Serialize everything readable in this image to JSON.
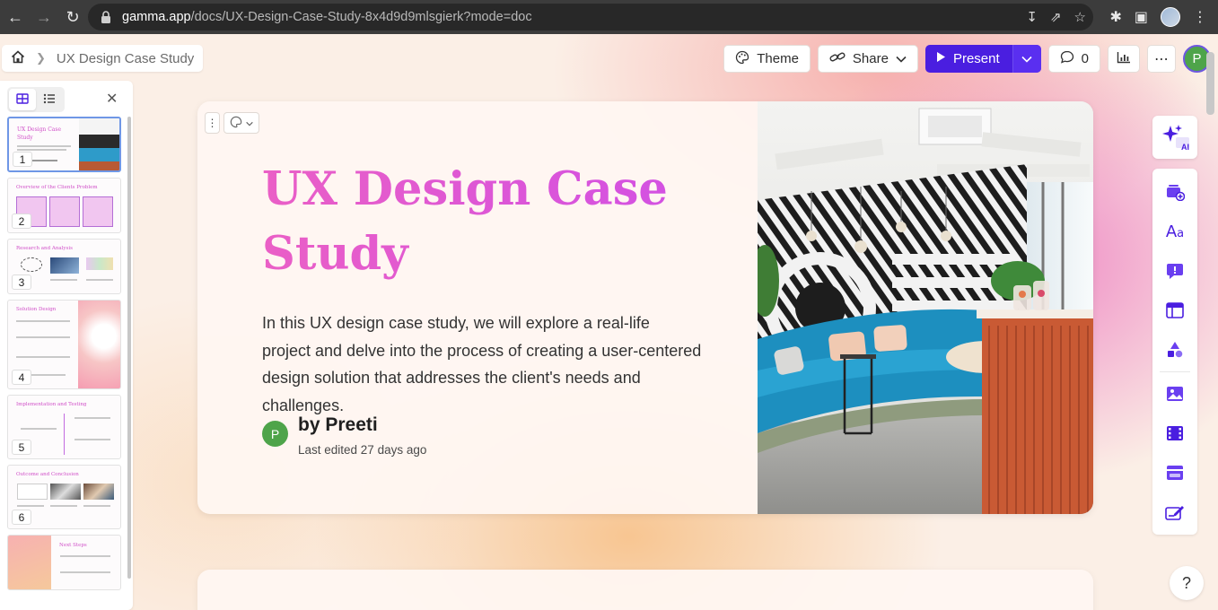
{
  "browser": {
    "url_host": "gamma.app",
    "url_path": "/docs/UX-Design-Case-Study-8x4d9d9mlsgierk?mode=doc"
  },
  "breadcrumb": {
    "doc_title": "UX Design Case Study"
  },
  "toolbar": {
    "theme_label": "Theme",
    "share_label": "Share",
    "present_label": "Present",
    "comment_count": "0",
    "avatar_initial": "P"
  },
  "panel": {
    "thumbnails": [
      {
        "number": "1",
        "title": "UX Design Case Study"
      },
      {
        "number": "2",
        "title": "Overview of the Clients Problem"
      },
      {
        "number": "3",
        "title": "Research and Analysis"
      },
      {
        "number": "4",
        "title": "Solution Design"
      },
      {
        "number": "5",
        "title": "Implementation and Testing"
      },
      {
        "number": "6",
        "title": "Outcome and Conclusion"
      },
      {
        "number": "",
        "title": "Next Steps"
      }
    ]
  },
  "slide": {
    "title": "UX Design Case Study",
    "description": "In this UX design case study, we will explore a real-life project and delve into the process of creating a user-centered design solution that addresses the client's needs and challenges.",
    "author_initial": "P",
    "author": "by Preeti",
    "last_edited": "Last edited 27 days ago"
  },
  "right_toolbar": {
    "ai_badge": "AI"
  },
  "help_label": "?",
  "colors": {
    "accent": "#4a1ee0",
    "title_pink": "#ea5fc6",
    "title_purple": "#d04fe6",
    "avatar_green": "#4ea44a"
  }
}
